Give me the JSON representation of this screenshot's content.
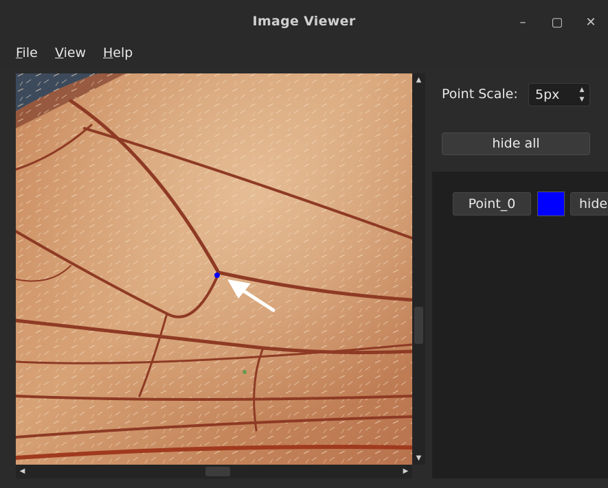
{
  "window": {
    "title": "Image Viewer",
    "minimize_glyph": "–",
    "maximize_glyph": "▢",
    "close_glyph": "✕"
  },
  "menu": {
    "items": [
      {
        "accel": "F",
        "rest": "ile"
      },
      {
        "accel": "V",
        "rest": "iew"
      },
      {
        "accel": "H",
        "rest": "elp"
      }
    ]
  },
  "controls": {
    "point_scale_label": "Point Scale:",
    "point_scale_value": "5px",
    "hide_all_label": "hide all"
  },
  "points": [
    {
      "label": "Point_0",
      "color": "#0000ff",
      "hide_label": "hide"
    }
  ],
  "image": {
    "subject": "insect wing close-up",
    "marker_color": "#0000ff"
  },
  "colors": {
    "background": "#2b2b2b",
    "panel": "#1f1f1f",
    "button": "#3a3a3a",
    "accent_point": "#0000ff"
  }
}
